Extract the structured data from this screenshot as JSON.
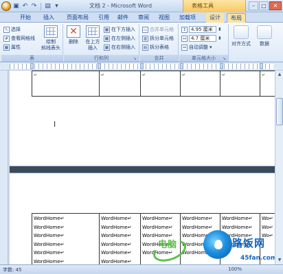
{
  "window": {
    "title": "文档 2 - Microsoft Word",
    "context_tool_title": "表格工具"
  },
  "tabs": [
    {
      "label": "开始"
    },
    {
      "label": "插入"
    },
    {
      "label": "页面布局"
    },
    {
      "label": "引用"
    },
    {
      "label": "邮件"
    },
    {
      "label": "审阅"
    },
    {
      "label": "视图"
    },
    {
      "label": "加载项"
    },
    {
      "label": "设计"
    },
    {
      "label": "布局"
    }
  ],
  "active_tab": "布局",
  "ribbon": {
    "table_group": {
      "label": "表",
      "select": "选择",
      "view_gridlines": "查看网格线",
      "properties": "属性",
      "draw_diagonal": "绘制\n斜线表头"
    },
    "rows_cols_group": {
      "label": "行和列",
      "delete": "删除",
      "insert_above": "在上方\n插入",
      "insert_below": "在下方插入",
      "insert_left": "在左侧插入",
      "insert_right": "在右侧插入"
    },
    "merge_group": {
      "label": "合并",
      "merge_cells": "合并单元格",
      "split_cells": "拆分单元格",
      "split_table": "拆分表格"
    },
    "cell_size_group": {
      "label": "单元格大小",
      "height_value": "4.95 厘米",
      "width_value": "4.7 厘米",
      "autofit": "自动调整"
    },
    "alignment": "对齐方式",
    "data": "数据"
  },
  "document": {
    "table_top_cells": [
      "↵",
      "↵",
      "↵",
      "↵",
      "↵",
      "↵"
    ],
    "table_bottom_cells": [
      "WordHome↵\nWordHome↵\nWordHome↵\nWordHome↵\nWordHome↵\nWordHome↵",
      "WordHome↵\nWordHome↵\nWordHome↵\nWordHome↵\nWordHome↵\nWordHome↵",
      "WordHome↵\nWordHome↵\nWordHome↵\nWordHome↵\nWordHome↵",
      "WordHome↵\nWordHome↵\nWordHome↵\nWordHome↵\nWordHome↵",
      "WordHome↵\nWordHome↵\nWordHome↵\nWordHome↵",
      "Wo↵\nWo↵\nWo↵"
    ]
  },
  "watermark": {
    "green_text": "电脑",
    "blue_text": "路饭网",
    "sub_text": "45fan.com"
  },
  "statusbar": {
    "page_info": "字数: 45",
    "zoom": "100%"
  }
}
